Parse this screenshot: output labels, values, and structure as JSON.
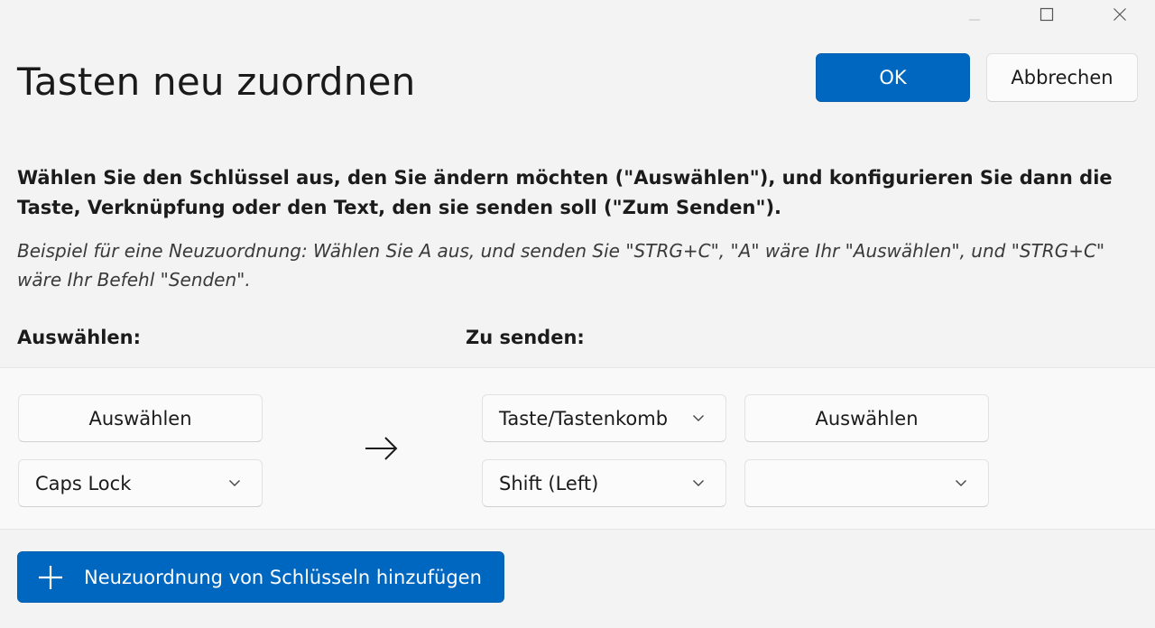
{
  "window": {
    "caption_icons": [
      "minimize-icon",
      "maximize-icon",
      "close-icon"
    ]
  },
  "header": {
    "title": "Tasten neu zuordnen",
    "ok_label": "OK",
    "cancel_label": "Abbrechen"
  },
  "instructions": {
    "description": "Wählen Sie den Schlüssel aus, den Sie ändern möchten (\"Auswählen\"), und konfigurieren Sie dann die Taste, Verknüpfung oder den Text, den sie senden soll (\"Zum Senden\").",
    "example": "Beispiel für eine Neuzuordnung: Wählen Sie A aus, und senden Sie \"STRG+C\", \"A\" wäre Ihr \"Auswählen\", und \"STRG+C\" wäre Ihr Befehl \"Senden\"."
  },
  "columns": {
    "select_label": "Auswählen:",
    "send_label": "Zu senden:"
  },
  "mapping": {
    "select_button_label": "Auswählen",
    "select_key_value": "Caps Lock",
    "send_type_value": "Taste/Tastenkomb",
    "send_select_button_label": "Auswählen",
    "send_key_value": "Shift (Left)",
    "send_extra_value": ""
  },
  "footer": {
    "add_button_label": "Neuzuordnung von Schlüsseln hinzufügen"
  },
  "colors": {
    "accent": "#0067c0",
    "background": "#f3f3f3"
  }
}
